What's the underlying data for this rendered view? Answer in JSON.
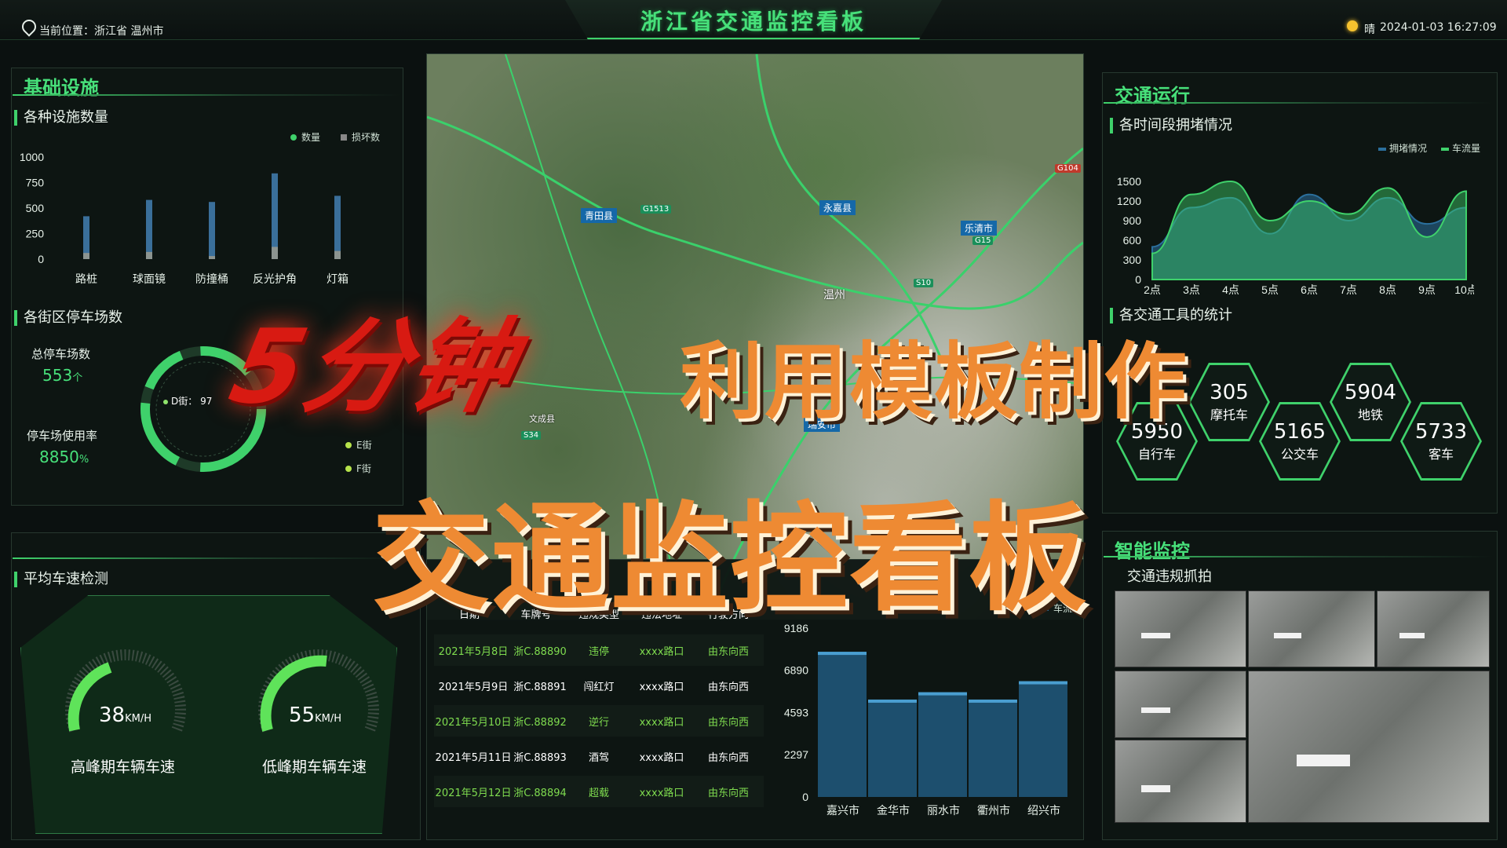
{
  "header": {
    "location": "当前位置：浙江省 温州市",
    "title": "浙江省交通监控看板",
    "weather": "晴",
    "datetime": "2024-01-03 16:27:09"
  },
  "left_top": {
    "panel_title": "基础设施",
    "facility_subtitle": "各种设施数量",
    "legend": [
      "数量",
      "损坏数"
    ],
    "y_ticks": [
      "1000",
      "750",
      "500",
      "250",
      "0"
    ],
    "categories": [
      "路桩",
      "球面镜",
      "防撞桶",
      "反光护角",
      "灯箱"
    ]
  },
  "parking": {
    "subtitle": "各街区停车场数",
    "total_label": "总停车场数",
    "total_value": "553",
    "total_unit": "个",
    "usage_label": "停车场使用率",
    "usage_value": "8850",
    "usage_unit": "%",
    "ring_label": "D街：",
    "ring_value": "97",
    "legend": [
      "E街",
      "F街"
    ]
  },
  "speed": {
    "subtitle": "平均车速检测",
    "gauges": [
      {
        "value": "38",
        "unit": "KM/H",
        "label": "高峰期车辆车速",
        "level": 0.38
      },
      {
        "value": "55",
        "unit": "KM/H",
        "label": "低峰期车辆车速",
        "level": 0.55
      }
    ]
  },
  "violations": {
    "headers": [
      "日期",
      "车牌号",
      "违规类型",
      "违法地址",
      "行驶方向"
    ],
    "rows": [
      [
        "2021年5月8日",
        "浙C.88890",
        "违停",
        "xxxx路口",
        "由东向西"
      ],
      [
        "2021年5月9日",
        "浙C.88891",
        "闯红灯",
        "xxxx路口",
        "由东向西"
      ],
      [
        "2021年5月10日",
        "浙C.88892",
        "逆行",
        "xxxx路口",
        "由东向西"
      ],
      [
        "2021年5月11日",
        "浙C.88893",
        "酒驾",
        "xxxx路口",
        "由东向西"
      ],
      [
        "2021年5月12日",
        "浙C.88894",
        "超载",
        "xxxx路口",
        "由东向西"
      ]
    ]
  },
  "map": {
    "labels": [
      "永嘉县",
      "乐清市",
      "青田县",
      "温州",
      "瑞安市",
      "文成县"
    ],
    "roads": [
      "G1513",
      "G15",
      "S10",
      "G104",
      "S34"
    ]
  },
  "right_top": {
    "panel_title": "交通运行",
    "subtitle": "各时间段拥堵情况",
    "legend": [
      "拥堵情况",
      "车流量"
    ],
    "colors": {
      "congestion": "#2b6f9c",
      "flow": "#3fd16b"
    }
  },
  "transport": {
    "subtitle": "各交通工具的统计",
    "items": [
      {
        "value": "5950",
        "label": "自行车"
      },
      {
        "value": "305",
        "label": "摩托车"
      },
      {
        "value": "5165",
        "label": "公交车"
      },
      {
        "value": "5904",
        "label": "地铁"
      },
      {
        "value": "5733",
        "label": "客车"
      }
    ]
  },
  "monitor": {
    "panel_title": "智能监控",
    "subtitle": "交通违规抓拍"
  },
  "promo": {
    "line1a": "5分钟",
    "line1b": "利用模板制作",
    "line2": "交通监控看板"
  },
  "chart_data": [
    {
      "type": "bar",
      "title": "各种设施数量",
      "categories": [
        "路桩",
        "球面镜",
        "防撞桶",
        "反光护角",
        "灯箱"
      ],
      "series": [
        {
          "name": "数量",
          "values": [
            420,
            580,
            560,
            840,
            620
          ]
        },
        {
          "name": "损坏数",
          "values": [
            60,
            70,
            30,
            120,
            80
          ]
        }
      ],
      "ylim": [
        0,
        1000
      ]
    },
    {
      "type": "area",
      "title": "各时间段拥堵情况",
      "x": [
        "2点",
        "3点",
        "4点",
        "5点",
        "6点",
        "7点",
        "8点",
        "9点",
        "10点"
      ],
      "series": [
        {
          "name": "拥堵情况",
          "values": [
            500,
            1100,
            1250,
            700,
            1300,
            900,
            1250,
            850,
            1100
          ]
        },
        {
          "name": "车流量",
          "values": [
            400,
            1300,
            1500,
            900,
            1200,
            1000,
            1400,
            650,
            1350
          ]
        }
      ],
      "y_ticks": [
        0,
        300,
        600,
        900,
        1200,
        1500
      ],
      "ylim": [
        0,
        1500
      ]
    },
    {
      "type": "bar",
      "title": "",
      "categories": [
        "嘉兴市",
        "金华市",
        "丽水市",
        "衢州市",
        "绍兴市"
      ],
      "series": [
        {
          "name": "车流量",
          "values": [
            7900,
            5300,
            5700,
            5300,
            6300
          ]
        }
      ],
      "y_ticks": [
        0,
        2297,
        4593,
        6890,
        9186
      ],
      "ylim": [
        0,
        9186
      ]
    }
  ]
}
